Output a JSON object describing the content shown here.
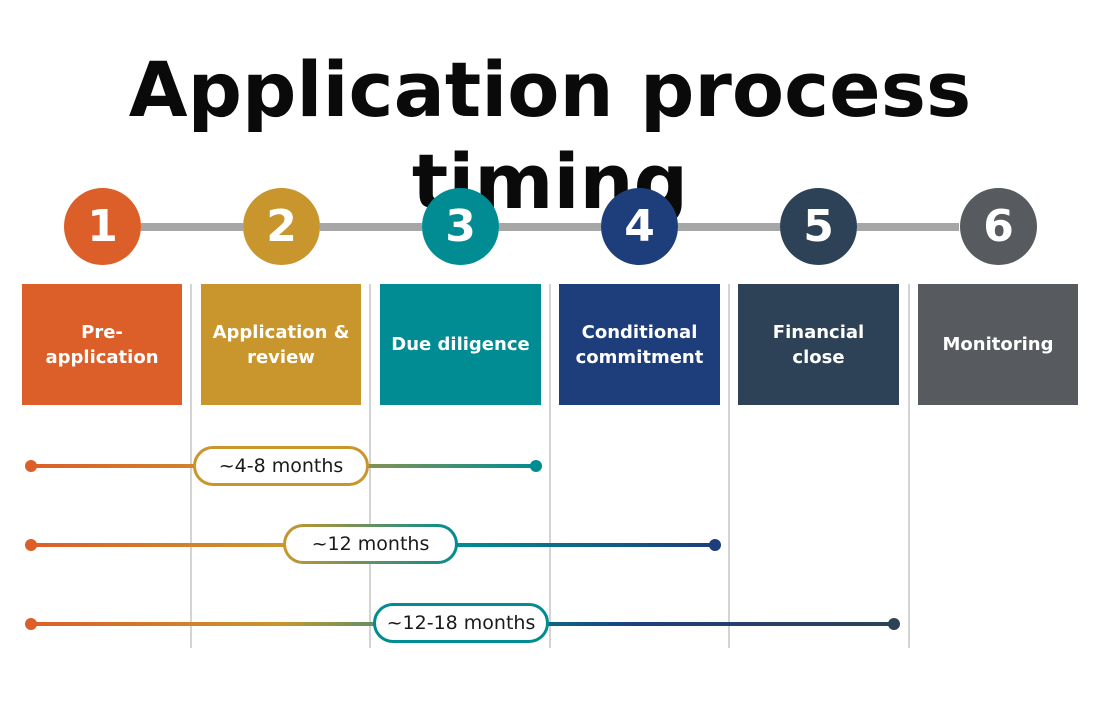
{
  "title": "Application process timing",
  "steps": [
    {
      "number": "1",
      "label": "Pre-application",
      "color": "#dc5e28"
    },
    {
      "number": "2",
      "label": "Application & review",
      "color": "#c9962e"
    },
    {
      "number": "3",
      "label": "Due diligence",
      "color": "#008c92"
    },
    {
      "number": "4",
      "label": "Conditional commitment",
      "color": "#1e3d7b"
    },
    {
      "number": "5",
      "label": "Financial close",
      "color": "#2d4256"
    },
    {
      "number": "6",
      "label": "Monitoring",
      "color": "#575b5f"
    }
  ],
  "connector_color": "#a6a6a6",
  "timelines": [
    {
      "label": "~4-8 months",
      "from_step": 1,
      "to_step": 3
    },
    {
      "label": "~12 months",
      "from_step": 1,
      "to_step": 4
    },
    {
      "label": "~12-18 months",
      "from_step": 1,
      "to_step": 5
    }
  ]
}
